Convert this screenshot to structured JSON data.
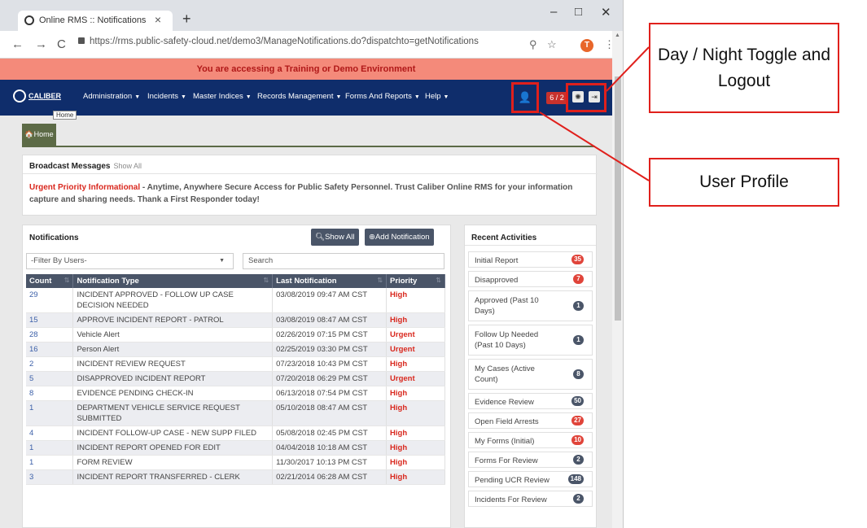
{
  "browser": {
    "tab_title": "Online RMS :: Notifications",
    "tab_close": "×",
    "new_tab": "+",
    "minimize": "–",
    "maximize": "□",
    "close": "✕",
    "back": "←",
    "forward": "→",
    "reload": "C",
    "url": "https://rms.public-safety-cloud.net/demo3/ManageNotifications.do?dispatchto=getNotifications",
    "profile_initial": "T",
    "menu_glyph": "⋮",
    "zoom_glyph": "⚲",
    "star_glyph": "☆"
  },
  "banner": {
    "text": "You are accessing a Training or Demo Environment"
  },
  "app_nav": {
    "brand": "CALIBER",
    "menus": [
      {
        "label": "Administration"
      },
      {
        "label": "Incidents"
      },
      {
        "label": "Master Indices"
      },
      {
        "label": "Records Management"
      },
      {
        "label": "Forms And Reports"
      },
      {
        "label": "Help"
      }
    ],
    "user_glyph": "👤",
    "count_badge": "6 / 2",
    "day_night_glyph": "✺",
    "logout_glyph": "⇥",
    "home_tooltip": "Home"
  },
  "home_tab": {
    "label": "🏠Home"
  },
  "broadcast": {
    "title": "Broadcast Messages",
    "show_all": "Show All",
    "urgent_label": "Urgent Priority Informational",
    "message": " - Anytime, Anywhere Secure Access for Public Safety Personnel. Trust Caliber Online RMS for your information capture and sharing needs. Thank a First Responder today!"
  },
  "notifications": {
    "title": "Notifications",
    "show_all_btn": "Show All",
    "add_btn": "Add Notification",
    "filter_placeholder": "-Filter By Users-",
    "search_label": "Search",
    "columns": [
      "Count",
      "Notification Type",
      "Last Notification",
      "Priority"
    ],
    "rows": [
      {
        "count": "29",
        "type": "INCIDENT APPROVED - FOLLOW UP CASE DECISION NEEDED",
        "last": "03/08/2019 09:47 AM CST",
        "priority": "High"
      },
      {
        "count": "15",
        "type": "APPROVE INCIDENT REPORT - PATROL",
        "last": "03/08/2019 08:47 AM CST",
        "priority": "High"
      },
      {
        "count": "28",
        "type": "Vehicle Alert",
        "last": "02/26/2019 07:15 PM CST",
        "priority": "Urgent"
      },
      {
        "count": "16",
        "type": "Person Alert",
        "last": "02/25/2019 03:30 PM CST",
        "priority": "Urgent"
      },
      {
        "count": "2",
        "type": "INCIDENT REVIEW REQUEST",
        "last": "07/23/2018 10:43 PM CST",
        "priority": "High"
      },
      {
        "count": "5",
        "type": "DISAPPROVED INCIDENT REPORT",
        "last": "07/20/2018 06:29 PM CST",
        "priority": "Urgent"
      },
      {
        "count": "8",
        "type": "EVIDENCE PENDING CHECK-IN",
        "last": "06/13/2018 07:54 PM CST",
        "priority": "High"
      },
      {
        "count": "1",
        "type": "DEPARTMENT VEHICLE SERVICE REQUEST SUBMITTED",
        "last": "05/10/2018 08:47 AM CST",
        "priority": "High"
      },
      {
        "count": "4",
        "type": "INCIDENT FOLLOW-UP CASE - NEW SUPP FILED",
        "last": "05/08/2018 02:45 PM CST",
        "priority": "High"
      },
      {
        "count": "1",
        "type": "INCIDENT REPORT OPENED FOR EDIT",
        "last": "04/04/2018 10:18 AM CST",
        "priority": "High"
      },
      {
        "count": "1",
        "type": "FORM REVIEW",
        "last": "11/30/2017 10:13 PM CST",
        "priority": "High"
      },
      {
        "count": "3",
        "type": "INCIDENT REPORT TRANSFERRED - CLERK",
        "last": "02/21/2014 06:28 AM CST",
        "priority": "High"
      }
    ]
  },
  "recent": {
    "title": "Recent Activities",
    "items": [
      {
        "label": "Initial Report",
        "badge": "35",
        "color": "#e0443a"
      },
      {
        "label": "Disapproved",
        "badge": "7",
        "color": "#e0443a"
      },
      {
        "label": "Approved (Past 10 Days)",
        "badge": "1",
        "color": "#4a5568"
      },
      {
        "label": "Follow Up Needed (Past 10 Days)",
        "badge": "1",
        "color": "#4a5568"
      },
      {
        "label": "My Cases (Active Count)",
        "badge": "8",
        "color": "#4a5568"
      },
      {
        "label": "Evidence Review",
        "badge": "50",
        "color": "#4a5568"
      },
      {
        "label": "Open Field Arrests",
        "badge": "27",
        "color": "#e0443a"
      },
      {
        "label": "My Forms (Initial)",
        "badge": "10",
        "color": "#e0443a"
      },
      {
        "label": "Forms For Review",
        "badge": "2",
        "color": "#4a5568"
      },
      {
        "label": "Pending UCR Review",
        "badge": "148",
        "color": "#4a5568"
      },
      {
        "label": "Incidents For Review",
        "badge": "2",
        "color": "#4a5568"
      }
    ]
  },
  "annotations": {
    "toggle_callout": "Day / Night Toggle and Logout",
    "profile_callout": "User Profile",
    "accent": "#e0201c"
  }
}
